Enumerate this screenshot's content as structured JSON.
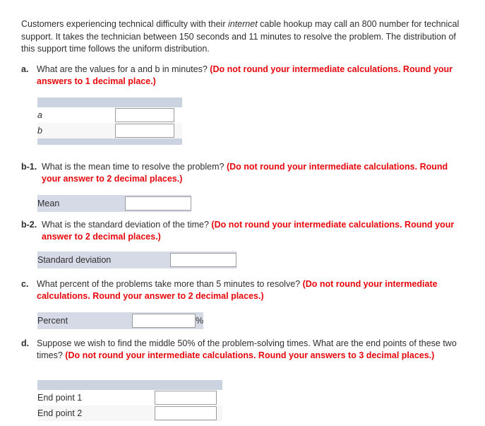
{
  "intro": {
    "part1": "Customers experiencing technical difficulty with their ",
    "italic": "internet",
    "part2": " cable hookup may call an 800 number for technical support. It takes the technician between 150 seconds and 11 minutes to resolve the problem. The distribution of this support time follows the uniform distribution."
  },
  "questions": [
    {
      "id": "a",
      "label": "a.",
      "text": "What are the values for a and b in minutes? ",
      "red": "(Do not round your intermediate calculations. Round your answers to 1 decimal place.)"
    },
    {
      "id": "b1",
      "label": "b-1.",
      "text": "What is the mean time to resolve the problem? ",
      "red": "(Do not round your intermediate calculations. Round your answer to 2 decimal places.)"
    },
    {
      "id": "b2",
      "label": "b-2.",
      "text": "What is the standard deviation of the time? ",
      "red": "(Do not round your intermediate calculations. Round your answer to 2 decimal places.)"
    },
    {
      "id": "c",
      "label": "c.",
      "text": "What percent of the problems take more than 5 minutes to resolve? ",
      "red": "(Do not round your intermediate calculations. Round your answer to 2 decimal places.)"
    },
    {
      "id": "d",
      "label": "d.",
      "text": "Suppose we wish to find the middle 50% of the problem-solving times. What are the end points of these two times? ",
      "red": "(Do not round your intermediate calculations. Round your answers to 3 decimal places.)"
    }
  ],
  "tables": {
    "ab": {
      "rows": [
        {
          "label": "a",
          "value": ""
        },
        {
          "label": "b",
          "value": ""
        }
      ]
    },
    "mean": {
      "rows": [
        {
          "label": "Mean",
          "value": ""
        }
      ]
    },
    "sd": {
      "rows": [
        {
          "label": "Standard deviation",
          "value": ""
        }
      ]
    },
    "percent": {
      "rows": [
        {
          "label": "Percent",
          "value": "",
          "suffix": "%"
        }
      ]
    },
    "endpoints": {
      "rows": [
        {
          "label": "End point 1",
          "value": ""
        },
        {
          "label": "End point 2",
          "value": ""
        }
      ]
    }
  },
  "colors": {
    "red_emphasis": "#e8070c",
    "header_bar": "#ccd3e0",
    "row_shade": "#d6dae6",
    "body_text": "#2e2e2e"
  }
}
